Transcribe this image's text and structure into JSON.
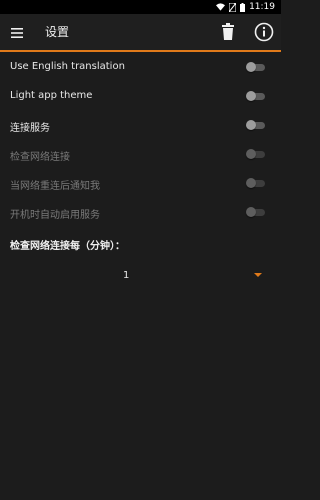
{
  "status_bar": {
    "time": "11:19"
  },
  "toolbar": {
    "title": "设置"
  },
  "settings": [
    {
      "label": "Use English translation",
      "enabled": true,
      "checked": false
    },
    {
      "label": "Light app theme",
      "enabled": true,
      "checked": false
    },
    {
      "label": "连接服务",
      "enabled": true,
      "checked": false
    },
    {
      "label": "检查网络连接",
      "enabled": false,
      "checked": false
    },
    {
      "label": "当网络重连后通知我",
      "enabled": false,
      "checked": false
    },
    {
      "label": "开机时自动启用服务",
      "enabled": false,
      "checked": false
    }
  ],
  "interval": {
    "label": "检查网络连接每（分钟）：",
    "value": "1"
  },
  "colors": {
    "accent": "#e07a1a",
    "background": "#1c1c1c"
  },
  "icons": {
    "menu": "hamburger-menu-icon",
    "delete": "trash-icon",
    "info": "info-icon",
    "wifi": "wifi-icon",
    "sim": "no-sim-icon",
    "battery": "battery-icon"
  }
}
